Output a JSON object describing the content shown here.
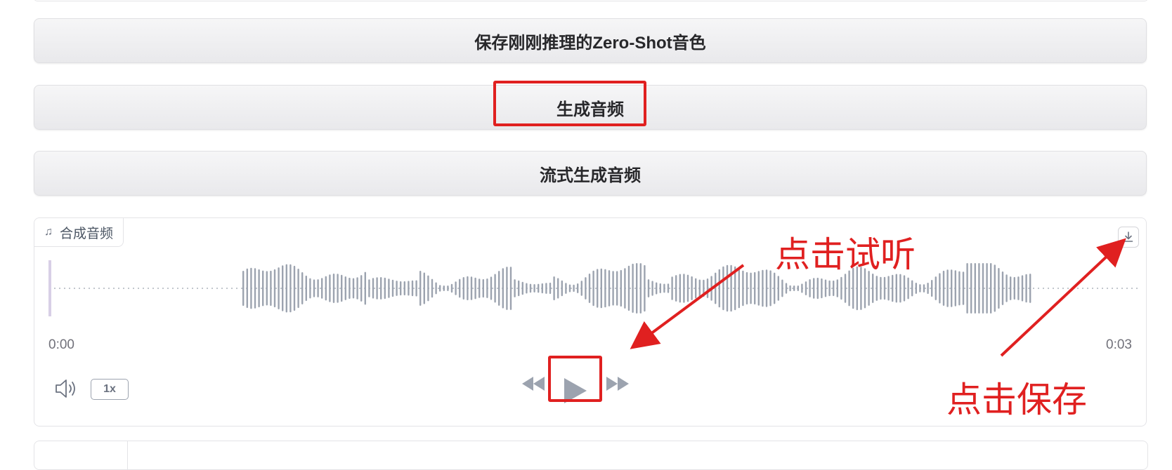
{
  "buttons": {
    "save_voice": "保存刚刚推理的Zero-Shot音色",
    "generate": "生成音频",
    "stream_generate": "流式生成音频"
  },
  "audio": {
    "label": "合成音频",
    "time_start": "0:00",
    "time_end": "0:03",
    "playback_rate": "1x"
  },
  "annotations": {
    "listen": "点击试听",
    "save": "点击保存"
  },
  "colors": {
    "accent_red": "#e02020",
    "waveform": "#9ca3af",
    "playhead": "#d8cfe6"
  },
  "icons": [
    "music-note-icon",
    "download-icon",
    "volume-icon",
    "skip-backward-icon",
    "play-icon",
    "skip-forward-icon"
  ]
}
